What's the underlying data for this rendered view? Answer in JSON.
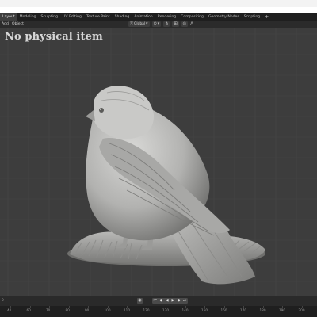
{
  "app": {
    "workspace_tabs": [
      "Layout",
      "Modeling",
      "Sculpting",
      "UV Editing",
      "Texture Paint",
      "Shading",
      "Animation",
      "Rendering",
      "Compositing",
      "Geometry Nodes",
      "Scripting"
    ],
    "active_tab": "Layout",
    "add_tab": "+"
  },
  "header": {
    "menu": [
      "Add",
      "Object"
    ],
    "orientation": "Global"
  },
  "viewport": {
    "watermark": "No physical item",
    "background_color": "#3d3d3d",
    "grid_color": "#474747"
  },
  "timeline": {
    "frame_markers": [
      "40",
      "60",
      "70",
      "80",
      "90",
      "100",
      "110",
      "120",
      "130",
      "140",
      "150",
      "160",
      "170",
      "180",
      "190",
      "200"
    ],
    "left_marker": "0"
  },
  "icons": {
    "playback": [
      "jump-start-icon",
      "prev-key-icon",
      "play-reverse-icon",
      "play-icon",
      "next-key-icon",
      "jump-end-icon"
    ]
  }
}
